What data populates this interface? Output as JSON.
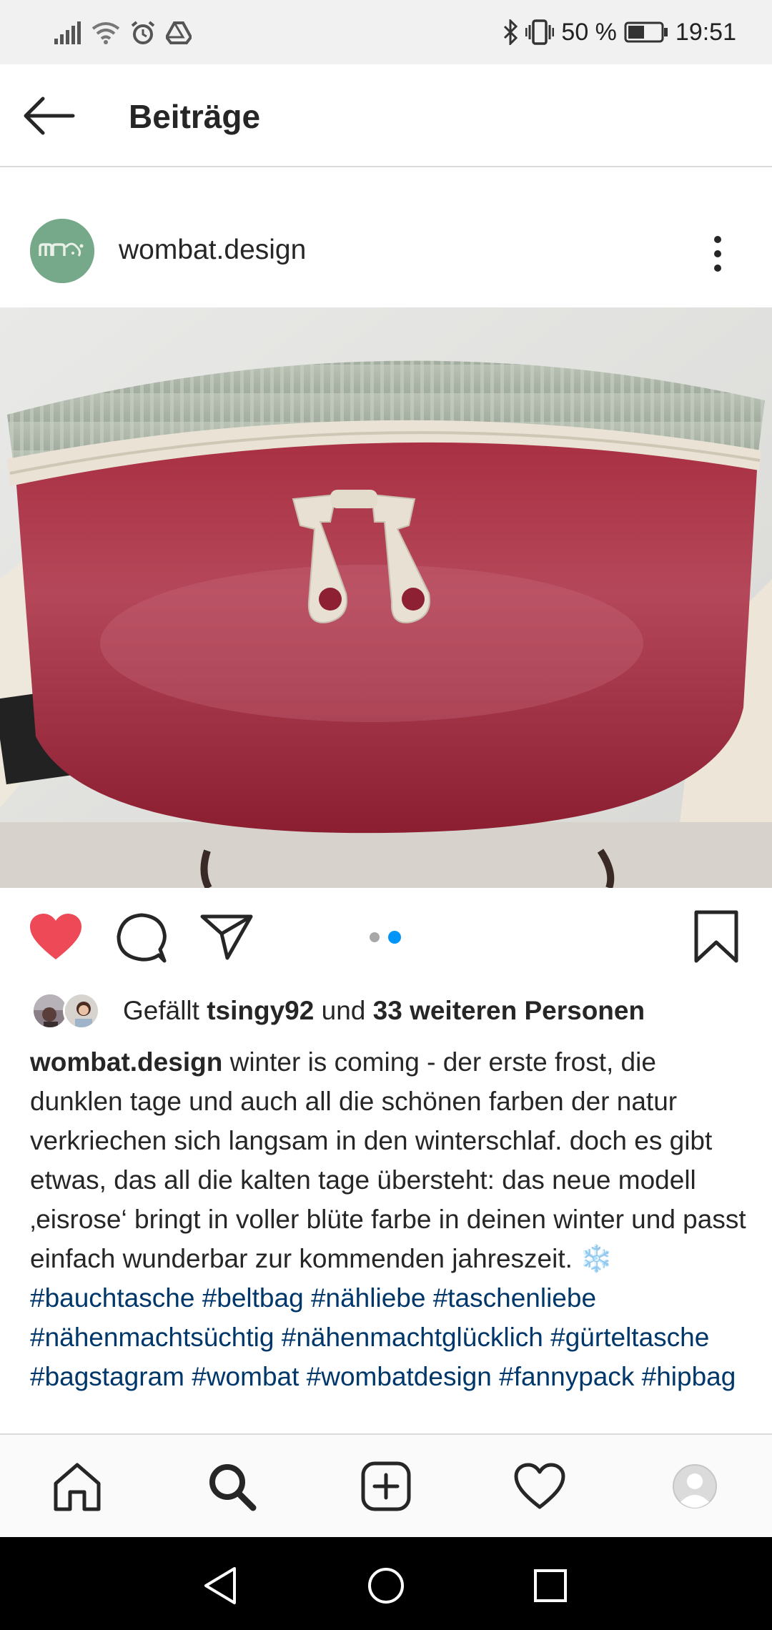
{
  "status_bar": {
    "battery_percent": "50 %",
    "time": "19:51",
    "icons": [
      "signal-icon",
      "wifi-icon",
      "alarm-icon",
      "drive-icon",
      "bluetooth-icon",
      "vibrate-icon",
      "battery-icon"
    ]
  },
  "header": {
    "title": "Beiträge",
    "back_icon": "arrow-left-icon"
  },
  "post": {
    "username": "wombat.design",
    "avatar_color": "#76a989",
    "carousel": {
      "total": 2,
      "current": 2
    },
    "liked": true,
    "likes": {
      "prefix": "Gefällt ",
      "user": "tsingy92",
      "middle": " und ",
      "others": "33 weiteren Personen"
    },
    "caption": {
      "user": "wombat.design",
      "text": " winter is coming - der erste frost, die dunklen tage und auch all die schönen farben der natur verkriechen sich langsam in den winterschlaf. doch es gibt etwas, das all die kalten tage übersteht: das neue modell ‚eisrose‘ bringt in voller blüte farbe in deinen winter und passt einfach wunderbar zur kommenden jahreszeit. ",
      "emoji": "❄️",
      "hashtags": [
        "#bauchtasche",
        "#beltbag",
        "#nähliebe",
        "#taschenliebe",
        "#nähenmachtsüchtig",
        "#nähenmachtglücklich",
        "#gürteltasche",
        "#bagstagram",
        "#wombat",
        "#wombatdesign",
        "#fannypack",
        "#hipbag"
      ]
    }
  },
  "colors": {
    "heart_red": "#ed4956",
    "hashtag_blue": "#00376b",
    "dot_active": "#0095f6"
  },
  "bottom_nav": [
    "home-icon",
    "search-icon",
    "add-post-icon",
    "activity-heart-icon",
    "profile-icon"
  ],
  "system_nav": [
    "back-triangle-icon",
    "home-circle-icon",
    "recents-square-icon"
  ]
}
